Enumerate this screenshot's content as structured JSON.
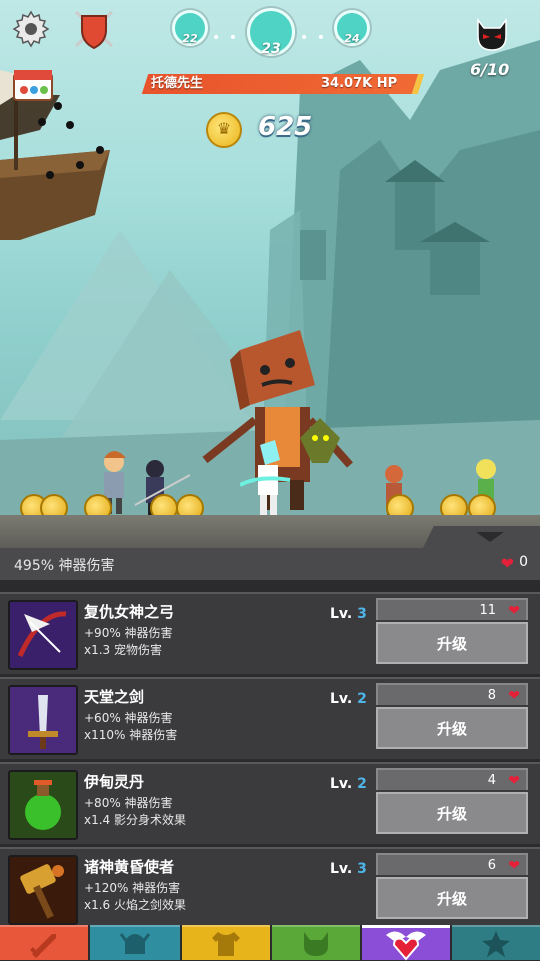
{
  "hud": {
    "stages": {
      "prev": "22",
      "current": "23",
      "next": "24"
    },
    "boss_name": "托德先生",
    "boss_hp": "34.07K HP",
    "gold": "625",
    "wave": "6/10"
  },
  "strip": {
    "artifact_damage": "495% 神器伤害",
    "heart_count": "0"
  },
  "artifacts": [
    {
      "name": "复仇女神之弓",
      "effect1": "+90% 神器伤害",
      "effect2": "x1.3 宠物伤害",
      "level_prefix": "Lv.",
      "level": "3",
      "cost": "11",
      "button": "升级",
      "icon": "bow-icon"
    },
    {
      "name": "天堂之剑",
      "effect1": "+60% 神器伤害",
      "effect2": "x110% 神器伤害",
      "level_prefix": "Lv.",
      "level": "2",
      "cost": "8",
      "button": "升级",
      "icon": "sword-icon"
    },
    {
      "name": "伊甸灵丹",
      "effect1": "+80% 神器伤害",
      "effect2": "x1.4 影分身术效果",
      "level_prefix": "Lv.",
      "level": "2",
      "cost": "4",
      "button": "升级",
      "icon": "potion-icon"
    },
    {
      "name": "诸神黄昏使者",
      "effect1": "+120% 神器伤害",
      "effect2": "x1.6 火焰之剑效果",
      "level_prefix": "Lv.",
      "level": "3",
      "cost": "6",
      "button": "升级",
      "icon": "hammer-icon"
    }
  ],
  "tabs": [
    {
      "icon": "sword-tab-icon",
      "color": "#e8573a"
    },
    {
      "icon": "helmet-tab-icon",
      "color": "#2f8fa0"
    },
    {
      "icon": "shirt-tab-icon",
      "color": "#e8b41c"
    },
    {
      "icon": "pet-tab-icon",
      "color": "#5aa838"
    },
    {
      "icon": "artifact-tab-icon",
      "color": "#8a4fd6"
    },
    {
      "icon": "star-tab-icon",
      "color": "#2e7d85"
    }
  ]
}
